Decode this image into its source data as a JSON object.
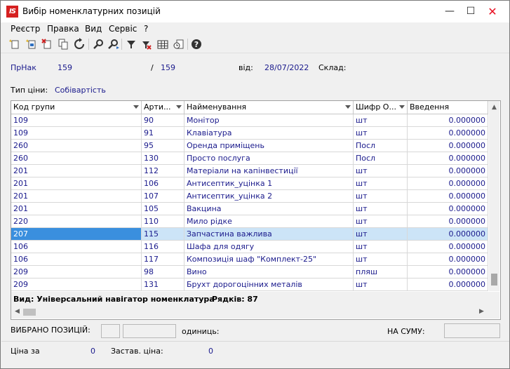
{
  "window": {
    "title": "Вибір номенклатурних позицій",
    "icon_text": "IS"
  },
  "menu": [
    "Реєстр",
    "Правка",
    "Вид",
    "Сервіс",
    "?"
  ],
  "header": {
    "doc_type": "ПрНак",
    "doc_number": "159",
    "separator": "/",
    "doc_number2": "159",
    "from_label": "від:",
    "date": "28/07/2022",
    "warehouse_label": "Склад:",
    "price_type_label": "Тип ціни:",
    "price_type_value": "Собівартість"
  },
  "table": {
    "columns": [
      "Код групи",
      "Арти...",
      "Найменування",
      "Шифр О...",
      "Введення"
    ],
    "rows": [
      [
        "109",
        "90",
        "Монітор",
        "шт",
        "0.000000"
      ],
      [
        "109",
        "91",
        "Клавіатура",
        "шт",
        "0.000000"
      ],
      [
        "260",
        "95",
        "Оренда приміщень",
        "Посл",
        "0.000000"
      ],
      [
        "260",
        "130",
        "Просто послуга",
        "Посл",
        "0.000000"
      ],
      [
        "201",
        "112",
        "Матеріали на капінвестиції",
        "шт",
        "0.000000"
      ],
      [
        "201",
        "106",
        "Антисептик_уцінка 1",
        "шт",
        "0.000000"
      ],
      [
        "201",
        "107",
        "Антисептик_уцінка 2",
        "шт",
        "0.000000"
      ],
      [
        "201",
        "105",
        "Вакцина",
        "шт",
        "0.000000"
      ],
      [
        "220",
        "110",
        "Мило рідке",
        "шт",
        "0.000000"
      ],
      [
        "207",
        "115",
        "Запчастина важлива",
        "шт",
        "0.000000"
      ],
      [
        "106",
        "116",
        "Шафа для одягу",
        "шт",
        "0.000000"
      ],
      [
        "106",
        "117",
        "Композиція шаф \"Комплект-25\"",
        "шт",
        "0.000000"
      ],
      [
        "209",
        "98",
        "Вино",
        "пляш",
        "0.000000"
      ],
      [
        "209",
        "131",
        "Брухт дорогоцінних металів",
        "шт",
        "0.000000"
      ]
    ],
    "selected_row": 9
  },
  "status": {
    "view_text": "Вид: Універсальний навігатор номенклатура",
    "rows_text": "Рядків: 87"
  },
  "footer": {
    "selected_label": "ВИБРАНО ПОЗИЦІЙ:",
    "units_label": "одиниць:",
    "sum_label": "НА СУМУ:",
    "price_label": "Ціна за",
    "price_value": "0",
    "deposit_label": "Застав. ціна:",
    "deposit_value": "0"
  },
  "colors": {
    "accent": "#1a1a8c",
    "selection": "#cce4f7",
    "selection_key": "#3a8fde",
    "brand": "#d62020"
  },
  "toolbar_icons": [
    "add-icon",
    "add-copy-icon",
    "delete-icon",
    "copy-icon",
    "refresh-icon",
    "find-icon",
    "find-next-icon",
    "filter-icon",
    "clear-filter-icon",
    "table-icon",
    "export-icon",
    "help-icon"
  ]
}
